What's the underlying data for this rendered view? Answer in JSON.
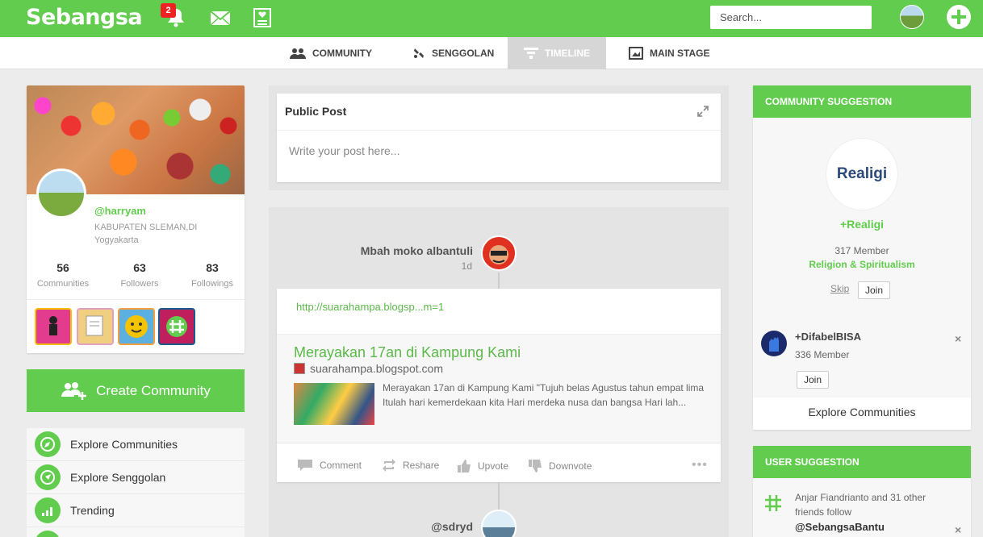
{
  "app": {
    "logo": "Sebangsa",
    "notification_count": "2",
    "search_placeholder": "Search..."
  },
  "tabs": [
    {
      "label": "COMMUNITY"
    },
    {
      "label": "SENGGOLAN"
    },
    {
      "label": "TIMELINE",
      "active": true
    },
    {
      "label": "MAIN STAGE"
    }
  ],
  "profile": {
    "username": "@harryam",
    "location": "KABUPATEN SLEMAN,DI Yogyakarta",
    "stats": [
      {
        "num": "56",
        "label": "Communities"
      },
      {
        "num": "63",
        "label": "Followers"
      },
      {
        "num": "83",
        "label": "Followings"
      }
    ]
  },
  "create_community": "Create Community",
  "menu": [
    {
      "label": "Explore Communities",
      "icon": "compass-icon"
    },
    {
      "label": "Explore Senggolan",
      "icon": "compass-arrow-icon"
    },
    {
      "label": "Trending",
      "icon": "trending-icon"
    }
  ],
  "public_post": {
    "title": "Public Post",
    "placeholder": "Write your post here..."
  },
  "feed": {
    "author": "Mbah moko albantuli",
    "time": "1d",
    "link": "http://suarahampa.blogsp...m=1",
    "preview_title": "Merayakan 17an di Kampung Kami",
    "preview_site": "suarahampa.blogspot.com",
    "preview_desc": "Merayakan 17an di Kampung Kami \"Tujuh belas Agustus tahun empat lima Itulah hari kemerdekaan kita Hari merdeka nusa dan bangsa Hari lah...",
    "actions": {
      "comment": "Comment",
      "reshare": "Reshare",
      "upvote": "Upvote",
      "downvote": "Downvote"
    },
    "more": "•••",
    "next_author": "@sdryd"
  },
  "community_suggestion": {
    "header": "COMMUNITY SUGGESTION",
    "featured": {
      "logo_text": "Realigi",
      "name": "+Realigi",
      "members": "317 Member",
      "category": "Religion & Spiritualism",
      "skip": "Skip",
      "join": "Join"
    },
    "second": {
      "name": "+DifabelBISA",
      "members": "336 Member",
      "join": "Join",
      "close": "×"
    },
    "explore": "Explore Communities"
  },
  "user_suggestion": {
    "header": "USER SUGGESTION",
    "text": "Anjar Fiandrianto and 31 other friends follow",
    "name": "@SebangsaBantu",
    "close": "×"
  },
  "colors": {
    "brand": "#62cc4e",
    "link": "#5cb84a"
  }
}
